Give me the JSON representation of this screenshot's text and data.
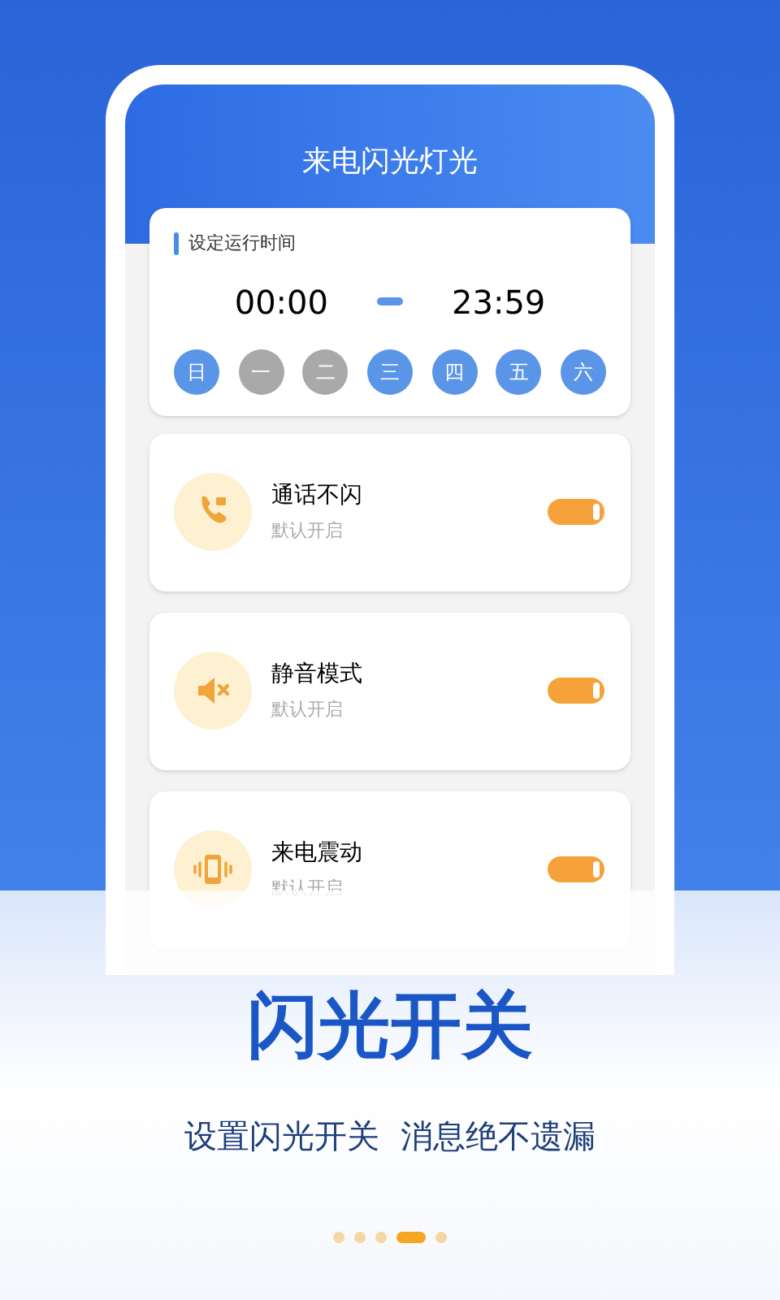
{
  "screen": {
    "title": "来电闪光灯光"
  },
  "schedule": {
    "heading": "设定运行时间",
    "start": "00:00",
    "end": "23:59",
    "days": [
      {
        "label": "日",
        "selected": true
      },
      {
        "label": "一",
        "selected": false
      },
      {
        "label": "二",
        "selected": false
      },
      {
        "label": "三",
        "selected": true
      },
      {
        "label": "四",
        "selected": true
      },
      {
        "label": "五",
        "selected": true
      },
      {
        "label": "六",
        "selected": true
      }
    ]
  },
  "settings": [
    {
      "kind": "phone",
      "title": "通话不闪",
      "subtitle": "默认开启",
      "on": true
    },
    {
      "kind": "mute",
      "title": "静音模式",
      "subtitle": "默认开启",
      "on": true
    },
    {
      "kind": "vibrate",
      "title": "来电震动",
      "subtitle": "默认开启",
      "on": true
    }
  ],
  "headline": "闪光开关",
  "tagline": "设置闪光开关  消息绝不遗漏",
  "pager": [
    {
      "selected": false
    },
    {
      "selected": false
    },
    {
      "selected": false
    },
    {
      "selected": true
    },
    {
      "selected": false
    }
  ]
}
